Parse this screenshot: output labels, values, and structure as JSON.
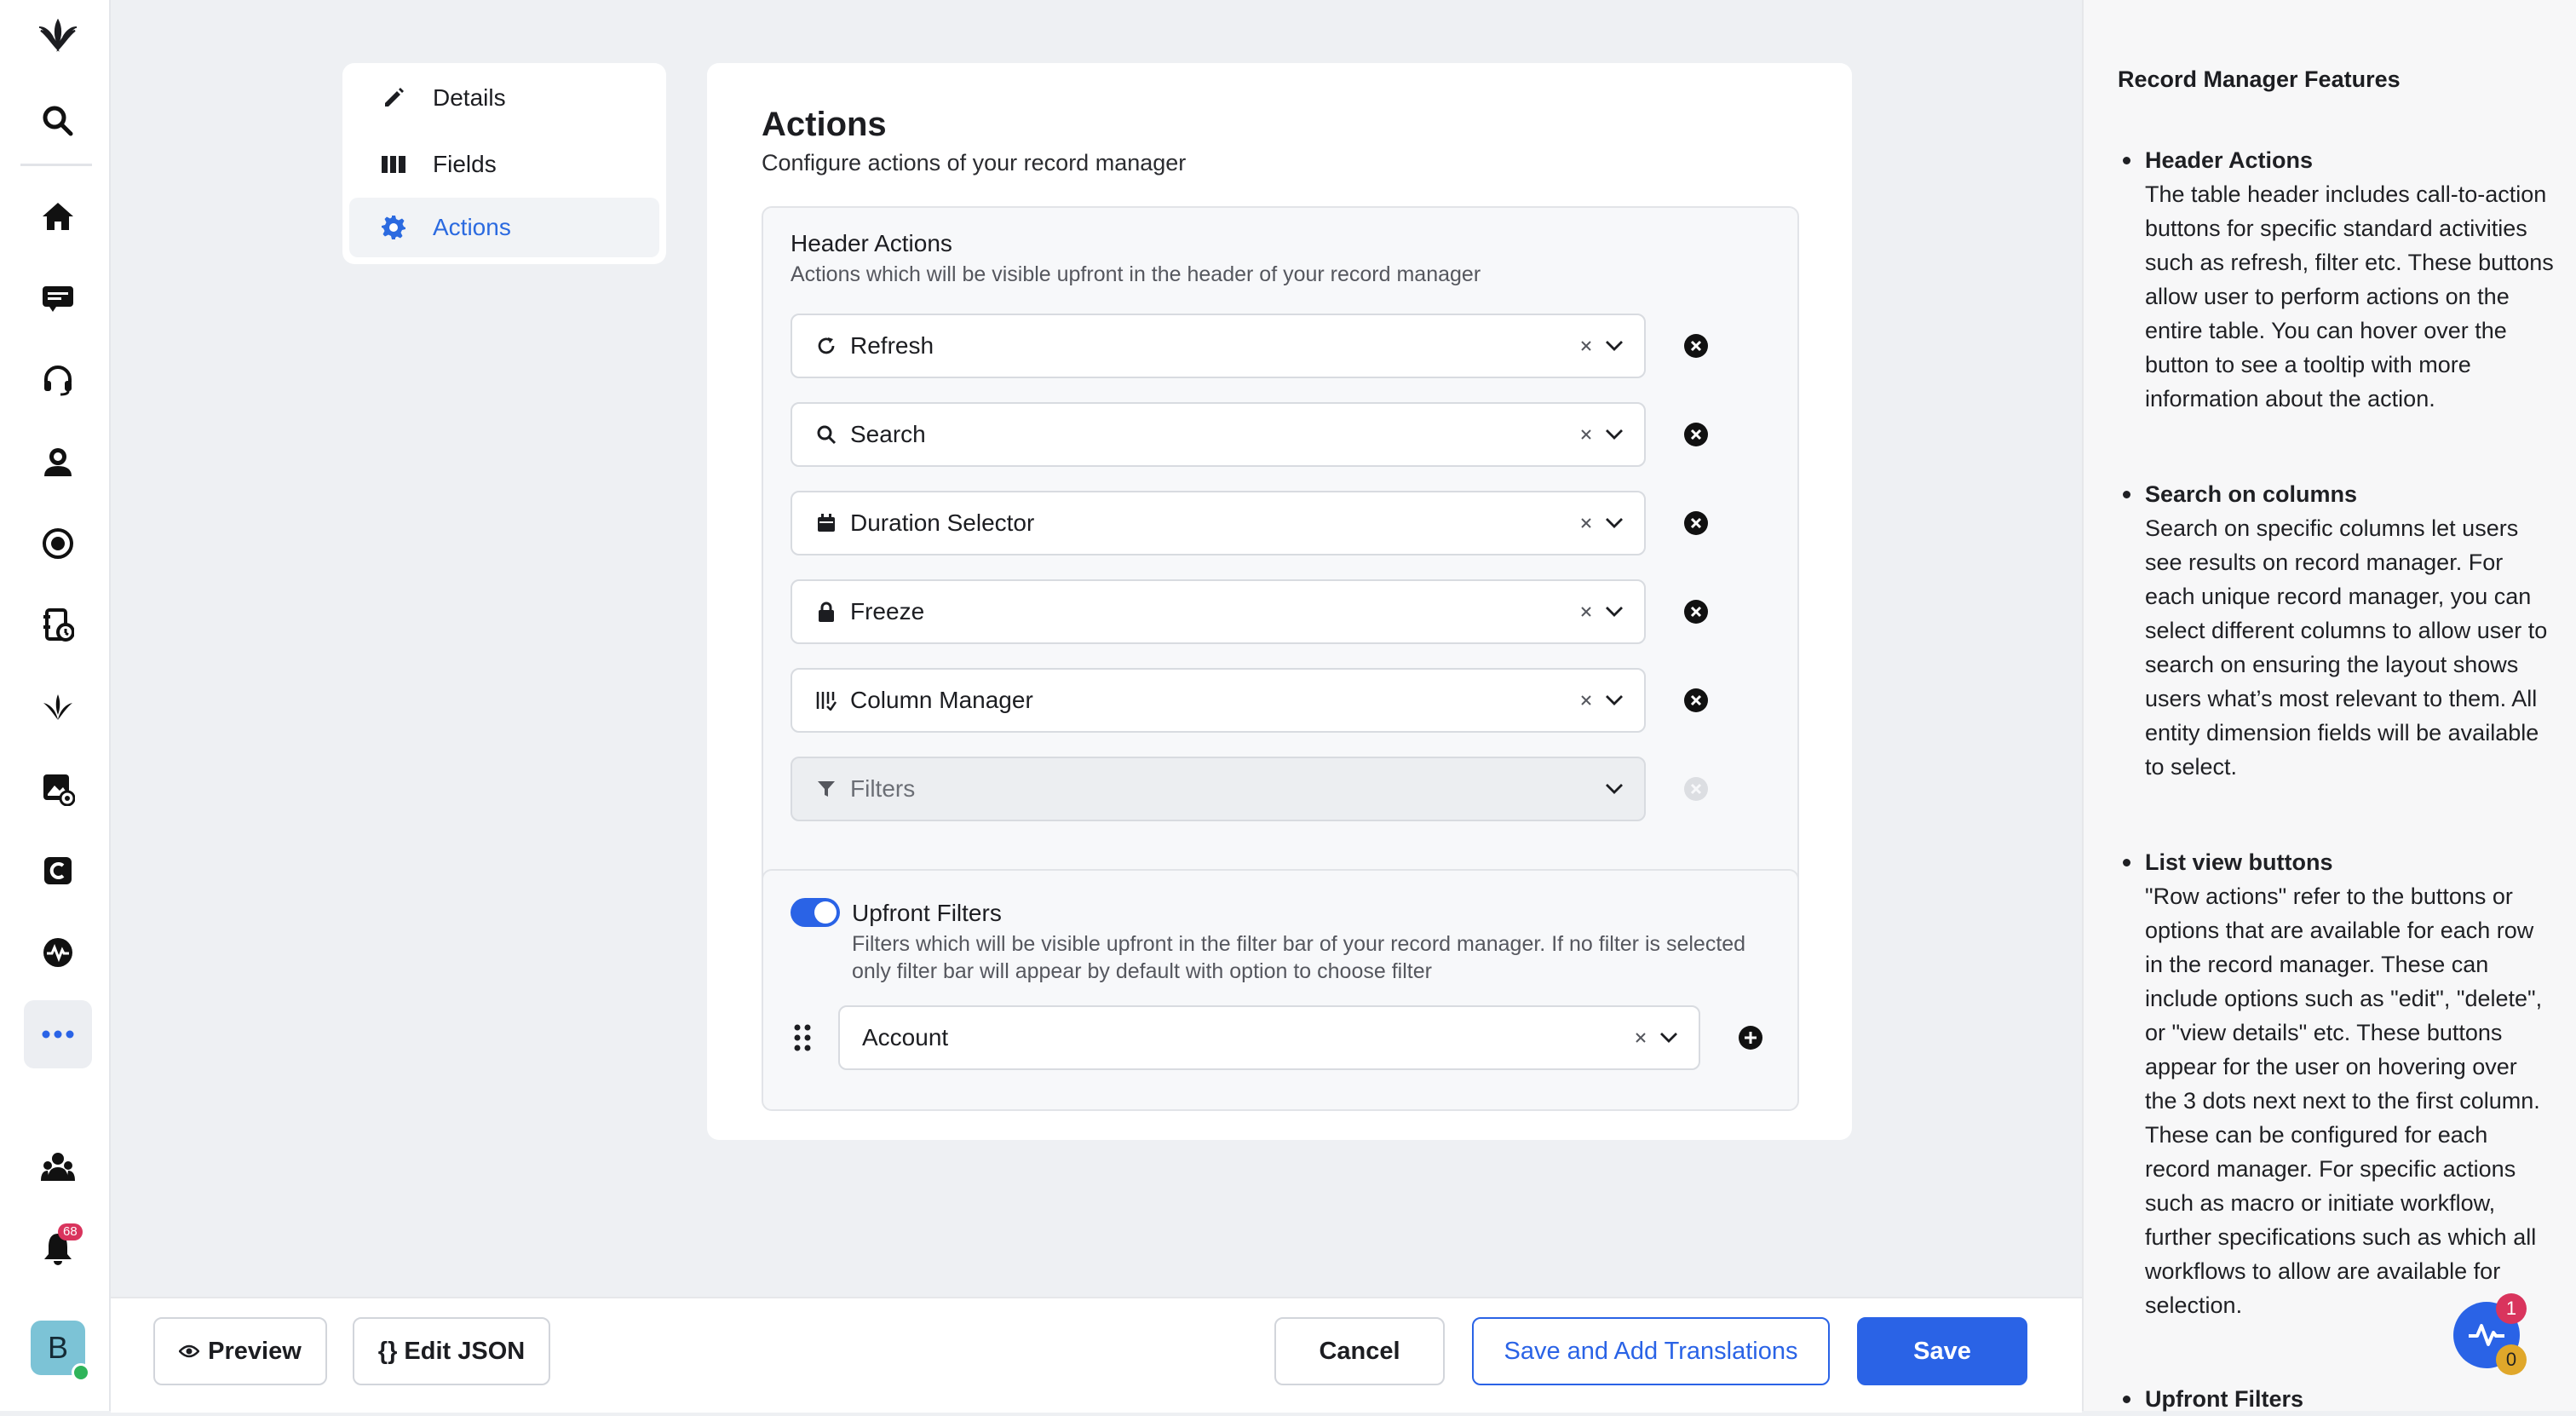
{
  "rail": {
    "icons": [
      "logo-icon",
      "search-icon",
      "home-icon",
      "ticket-icon",
      "headset-icon",
      "agent-icon",
      "target-icon",
      "report-icon",
      "sprout-icon",
      "image-settings-icon",
      "c-app-icon",
      "pulse-icon",
      "more-icon",
      "team-icon",
      "bell-icon"
    ],
    "bell_count": "68",
    "avatar_letter": "B"
  },
  "settings_menu": {
    "items": [
      {
        "label": "Details",
        "icon": "pencil-icon"
      },
      {
        "label": "Fields",
        "icon": "columns-icon"
      },
      {
        "label": "Actions",
        "icon": "gear-icon"
      }
    ],
    "active": "Actions"
  },
  "main": {
    "title": "Actions",
    "subtitle": "Configure actions of your record manager",
    "header_actions": {
      "title": "Header Actions",
      "subtitle": "Actions which will be visible upfront in the header of your record manager",
      "items": [
        {
          "label": "Refresh",
          "icon": "refresh-icon"
        },
        {
          "label": "Search",
          "icon": "search-icon"
        },
        {
          "label": "Duration Selector",
          "icon": "calendar-icon"
        },
        {
          "label": "Freeze",
          "icon": "lock-icon"
        },
        {
          "label": "Column Manager",
          "icon": "column-manager-icon"
        },
        {
          "label": "Filters",
          "icon": "filter-icon",
          "disabled": true
        }
      ]
    },
    "upfront_filters": {
      "title": "Upfront Filters",
      "enabled": true,
      "subtitle": "Filters which will be visible upfront in the filter bar of your record manager. If no filter is selected only filter bar will appear by default with option to choose filter",
      "selected": "Account"
    }
  },
  "info_panel": {
    "title": "Record Manager Features",
    "features": [
      {
        "title": "Header Actions",
        "text": "The table header includes call-to-action buttons for specific standard activities such as refresh, filter etc. These buttons allow user to perform actions on the entire table. You can hover over the button to see a tooltip with more information about the action."
      },
      {
        "title": "Search on columns",
        "text": "Search on specific columns let users see results on record manager. For each unique record manager, you can select different columns to allow user to search on ensuring the layout shows users what’s most relevant to them. All entity dimension fields will be available to select."
      },
      {
        "title": "List view buttons",
        "text": "\"Row actions\" refer to the buttons or options that are available for each row in the record manager. These can include options such as \"edit\", \"delete\", or \"view details\" etc. These buttons appear for the user on hovering over the 3 dots next next to the first column. These can be configured for each record manager. For specific actions such as macro or initiate workflow, further specifications such as which all workflows to allow are available for selection."
      },
      {
        "title": "Upfront Filters",
        "text": ""
      }
    ]
  },
  "footer": {
    "preview": "Preview",
    "edit_json": "{} Edit JSON",
    "cancel": "Cancel",
    "save_translations": "Save and Add Translations",
    "save": "Save"
  },
  "widget": {
    "badge_top": "1",
    "badge_bottom": "0"
  },
  "colors": {
    "accent": "#2a63e6",
    "badge": "#d9345d",
    "online": "#2fb45a"
  }
}
